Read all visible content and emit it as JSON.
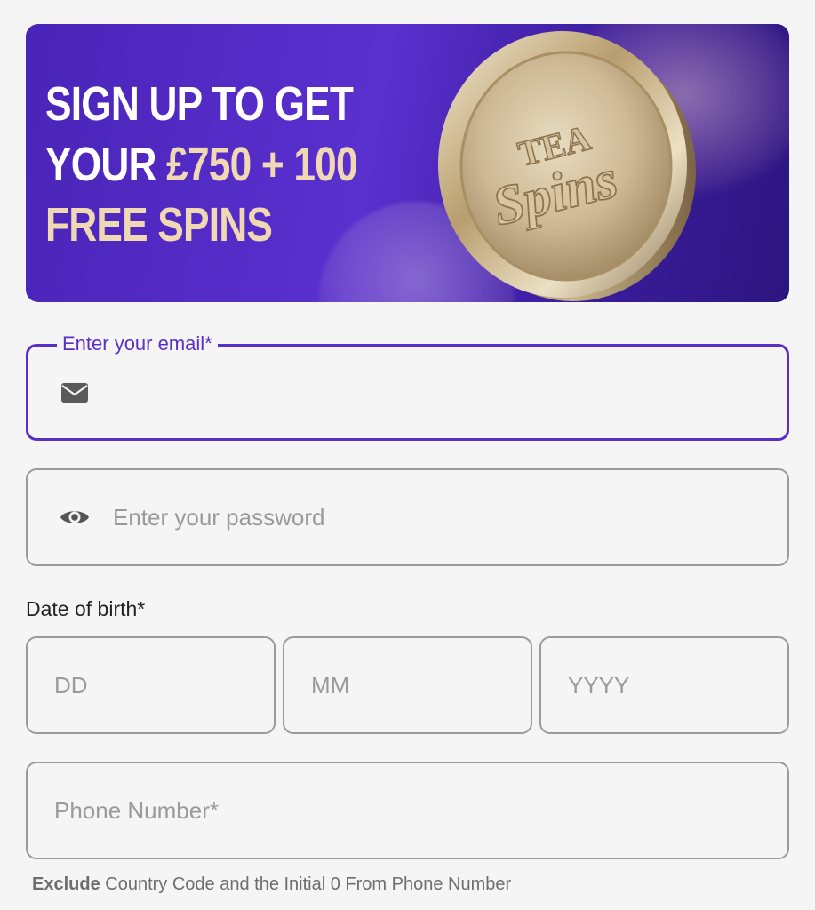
{
  "banner": {
    "line1": "SIGN UP TO GET",
    "line2_prefix": "YOUR ",
    "line2_accent": "£750 + 100",
    "line3": "FREE SPINS",
    "coin_text_top": "TEA",
    "coin_text_bottom": "Spins",
    "accent_color": "#efd8b2",
    "background_color": "#4a24b8"
  },
  "form": {
    "email": {
      "label": "Enter your email*",
      "value": "",
      "icon": "envelope-icon"
    },
    "password": {
      "placeholder": "Enter your password",
      "icon": "eye-icon"
    },
    "dob": {
      "label": "Date of birth*",
      "day_placeholder": "DD",
      "month_placeholder": "MM",
      "year_placeholder": "YYYY"
    },
    "phone": {
      "placeholder": "Phone Number*",
      "hint_bold": "Exclude",
      "hint_rest": " Country Code and the Initial 0 From Phone Number"
    },
    "active_border_color": "#5a2fc9"
  }
}
